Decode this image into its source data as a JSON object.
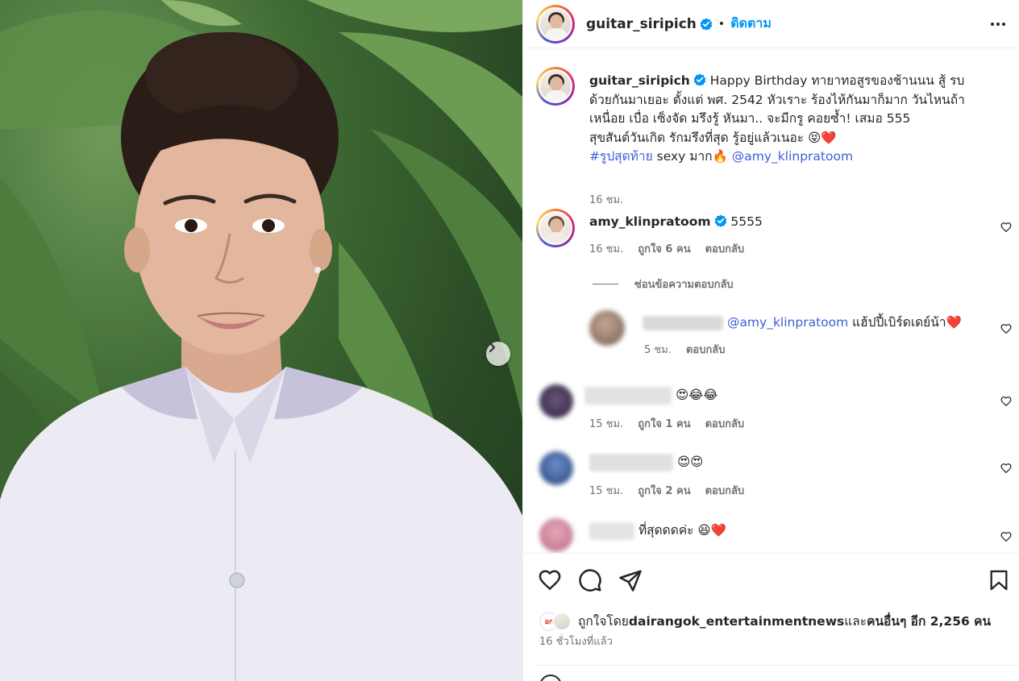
{
  "post": {
    "author": "guitar_siripich",
    "follow_label": "ติดตาม",
    "dot": "•"
  },
  "caption": {
    "username": "guitar_siripich",
    "text": "Happy Birthday ทายาทอสูรของช้านนน สู้ รบ ด้วยกันมาเยอะ ตั้งแต่ พศ. 2542 หัวเราะ ร้องไห้กันมาก็มาก วันไหนถ้าเหนื่อย เบื่อ เซ็งจัด มรึงรู้ หันมา.. จะมีกรู คอยซ้ำ! เสมอ 555",
    "line5": "สุขสันต์วันเกิด รักมรึงที่สุด รู้อยู่แล้วเนอะ 😝❤️",
    "hashtag": "#รูปสุดท้าย",
    "after_hashtag": " sexy มาก🔥 ",
    "mention": "@amy_klinpratoom",
    "time": "16 ชม."
  },
  "comments": [
    {
      "username": "amy_klinpratoom",
      "text": " 5555",
      "time": "16 ชม.",
      "likes": "ถูกใจ 6 คน",
      "reply": "ตอบกลับ"
    }
  ],
  "hide_replies_label": "ซ่อนข้อความตอบกลับ",
  "reply_1": {
    "mention": "@amy_klinpratoom",
    "text": " แฮ้ปปี้เบิร์ดเดย์น้า❤️",
    "time": "5 ชม.",
    "reply": "ตอบกลับ"
  },
  "comment_2": {
    "text": "😍😂😂",
    "time": "15 ชม.",
    "likes": "ถูกใจ 1 คน",
    "reply": "ตอบกลับ"
  },
  "comment_3": {
    "text": "😍😍",
    "time": "15 ชม.",
    "likes": "ถูกใจ 2 คน",
    "reply": "ตอบกลับ"
  },
  "comment_4": {
    "text": "ที่สุดดดค่ะ 😆❤️"
  },
  "likes_bar": {
    "prefix": "ถูกใจโดย ",
    "user": "dairangok_entertainmentnews",
    "middle": " และ",
    "others": "คนอื่นๆ อีก 2,256 คน",
    "badge": "อก"
  },
  "time_ago": "16 ชั่วโมงที่แล้ว",
  "colors": {
    "link": "#3d5fd8",
    "follow": "#0095f6",
    "verified": "#0095f6"
  }
}
